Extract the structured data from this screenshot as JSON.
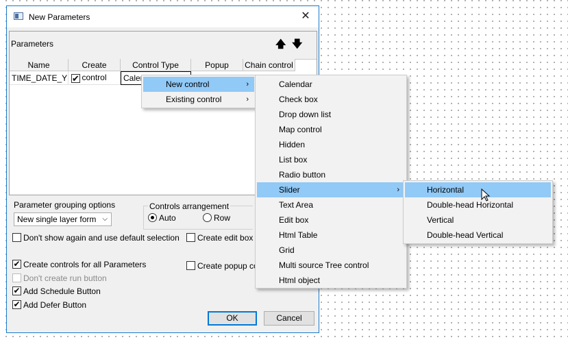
{
  "dialog": {
    "title": "New Parameters",
    "close_glyph": "✕",
    "section_label": "Parameters",
    "move_up_glyph": "🡅",
    "move_down_glyph": "🡇"
  },
  "table": {
    "columns": [
      "Name",
      "Create control",
      "Control Type",
      "Popup",
      "Chain control"
    ],
    "row": {
      "name": "TIME_DATE_YE",
      "create_control": true,
      "control_type": "Calen"
    }
  },
  "options": {
    "grouping_label": "Parameter grouping options",
    "grouping_value": "New single layer form",
    "arrangement_label": "Controls arrangement",
    "arrangement_auto": "Auto",
    "arrangement_row": "Row",
    "arrangement_selected": "Auto",
    "dont_show_again": "Don't show again and use default selection",
    "create_edit_box": "Create edit box co",
    "create_controls_all": "Create controls for all Parameters",
    "create_popup": "Create popup con",
    "dont_create_run": "Don't create run button",
    "add_schedule": "Add Schedule Button",
    "add_defer": "Add Defer Button"
  },
  "buttons": {
    "ok": "OK",
    "cancel": "Cancel"
  },
  "menu_l1": {
    "items": [
      "New control",
      "Existing control"
    ],
    "submenu_glyph": "›"
  },
  "menu_l2": {
    "items": [
      "Calendar",
      "Check box",
      "Drop down list",
      "Map control",
      "Hidden",
      "List box",
      "Radio button",
      "Slider",
      "Text Area",
      "Edit box",
      "Html Table",
      "Grid",
      "Multi source Tree control",
      "Html object"
    ]
  },
  "menu_l3": {
    "items": [
      "Horizontal",
      "Double-head  Horizontal",
      "Vertical",
      "Double-head  Vertical"
    ]
  },
  "colors": {
    "highlight": "#91c9f7",
    "dialog_border": "#1979ca",
    "ok_border": "#0078d7"
  }
}
